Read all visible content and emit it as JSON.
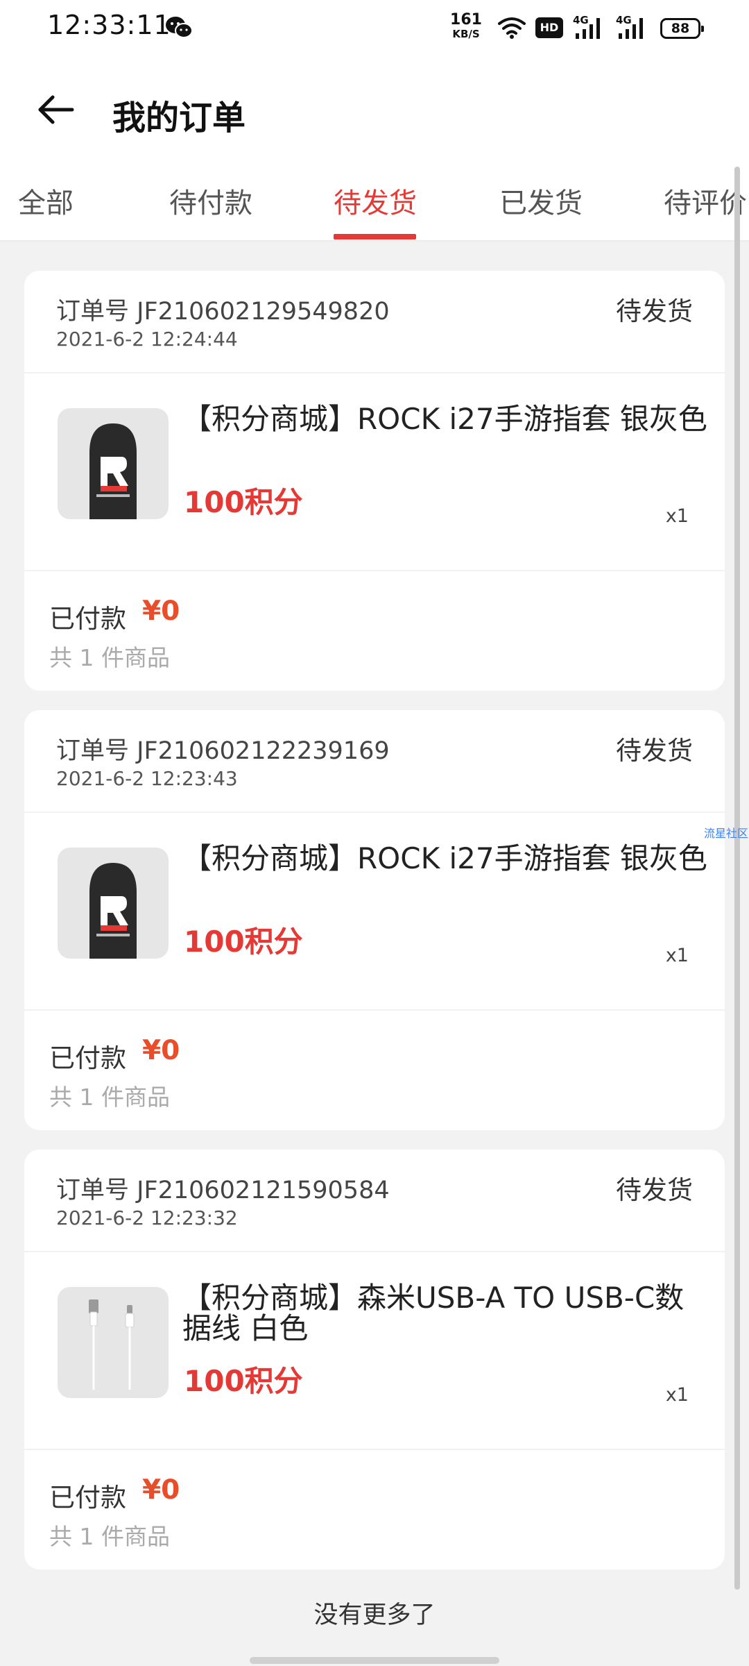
{
  "status_bar": {
    "time": "12:33:11",
    "net_speed_value": "161",
    "net_speed_unit": "KB/S",
    "hd_label": "HD",
    "signal_1": "4G",
    "signal_2": "4G",
    "battery": "88"
  },
  "header": {
    "title": "我的订单"
  },
  "tabs": [
    {
      "label": "全部",
      "active": false
    },
    {
      "label": "待付款",
      "active": false
    },
    {
      "label": "待发货",
      "active": true
    },
    {
      "label": "已发货",
      "active": false
    },
    {
      "label": "待评价",
      "active": false
    }
  ],
  "orders": [
    {
      "order_no": "订单号 JF210602129549820",
      "time": "2021-6-2 12:24:44",
      "status": "待发货",
      "product_title": "【积分商城】ROCK i27手游指套 银灰色",
      "price": "100积分",
      "qty": "x1",
      "paid_label": "已付款",
      "paid_amount": "¥0",
      "item_count": "共 1 件商品",
      "thumb_icon": "finger-sleeve-image"
    },
    {
      "order_no": "订单号 JF210602122239169",
      "time": "2021-6-2 12:23:43",
      "status": "待发货",
      "product_title": "【积分商城】ROCK i27手游指套 银灰色",
      "price": "100积分",
      "qty": "x1",
      "paid_label": "已付款",
      "paid_amount": "¥0",
      "item_count": "共 1 件商品",
      "thumb_icon": "finger-sleeve-image"
    },
    {
      "order_no": "订单号 JF210602121590584",
      "time": "2021-6-2 12:23:32",
      "status": "待发货",
      "product_title": "【积分商城】森米USB-A TO USB-C数据线 白色",
      "price": "100积分",
      "qty": "x1",
      "paid_label": "已付款",
      "paid_amount": "¥0",
      "item_count": "共 1 件商品",
      "thumb_icon": "usb-cable-image"
    }
  ],
  "side_link": "流星社区",
  "footer": {
    "no_more": "没有更多了"
  },
  "colors": {
    "accent": "#e53935",
    "paid": "#e94e2a",
    "background": "#f2f2f2"
  }
}
